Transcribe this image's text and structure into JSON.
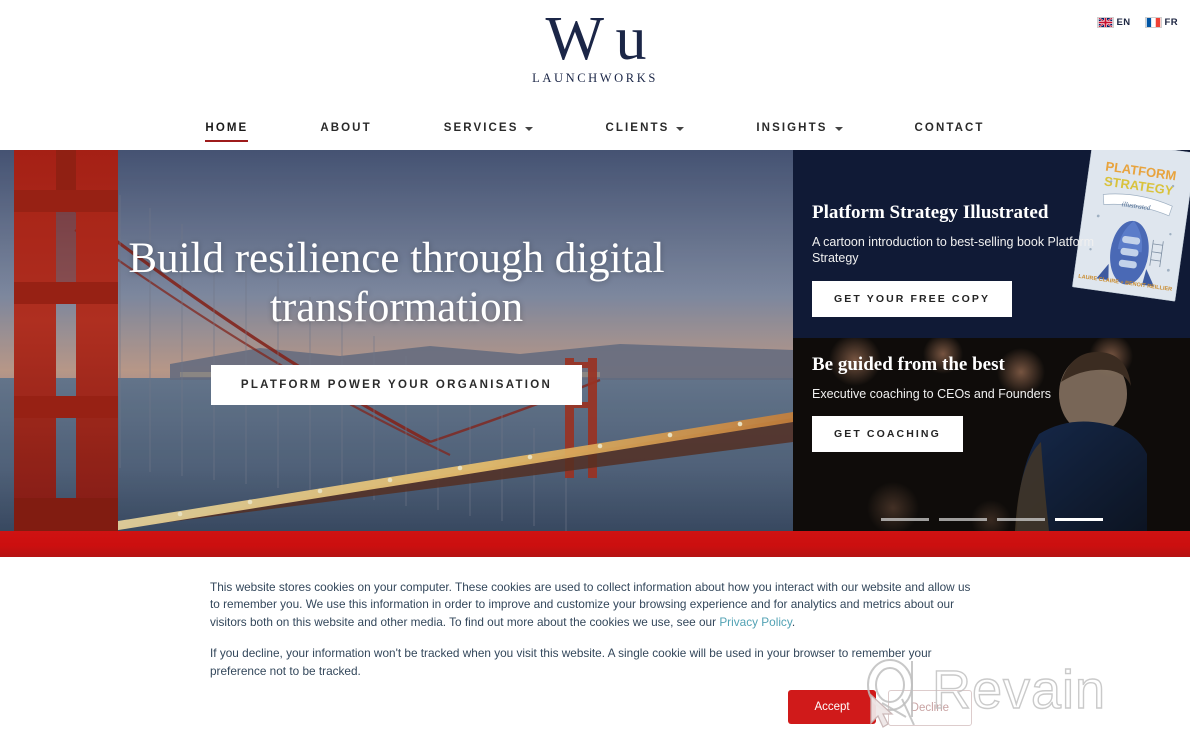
{
  "brand": {
    "logo_letter": "W",
    "logo_overlay": "u",
    "name": "LAUNCHWORKS"
  },
  "language_bar": {
    "items": [
      {
        "code": "EN",
        "flag": "uk-flag-icon"
      },
      {
        "code": "FR",
        "flag": "france-flag-icon"
      }
    ]
  },
  "nav": {
    "items": [
      {
        "label": "HOME",
        "active": true,
        "caret": false
      },
      {
        "label": "ABOUT",
        "active": false,
        "caret": false
      },
      {
        "label": "SERVICES",
        "active": false,
        "caret": true
      },
      {
        "label": "CLIENTS",
        "active": false,
        "caret": true
      },
      {
        "label": "INSIGHTS",
        "active": false,
        "caret": true
      },
      {
        "label": "CONTACT",
        "active": false,
        "caret": false
      }
    ]
  },
  "hero": {
    "title": "Build resilience through digital transformation",
    "cta_label": "PLATFORM POWER YOUR ORGANISATION",
    "image_alt": "golden-gate-bridge-at-dusk"
  },
  "promo_cards": [
    {
      "title": "Platform Strategy Illustrated",
      "subtitle": "A cartoon introduction to best-selling book Platform Strategy",
      "cta_label": "GET YOUR FREE COPY",
      "background": "#101a36",
      "book_title_line1": "PLATFORM",
      "book_title_line2": "STRATEGY",
      "book_script": "illustrated"
    },
    {
      "title": "Be guided from the best",
      "subtitle": "Executive coaching to CEOs and Founders",
      "cta_label": "GET COACHING",
      "background": "#1a1410",
      "image_alt": "woman-looking-up-night-lights"
    }
  ],
  "carousel": {
    "slides": 4,
    "active_index": 3
  },
  "divider": {
    "color": "#cc0f0f"
  },
  "cookie_banner": {
    "paragraph_1_part_1": "This website stores cookies on your computer. These cookies are used to collect information about how you interact with our website and allow us to remember you. We use this information in order to improve and customize your browsing experience and for analytics and metrics about our visitors both on this website and other media. To find out more about the cookies we use, see our ",
    "privacy_link_label": "Privacy Policy",
    "paragraph_1_part_2": ".",
    "paragraph_2": "If you decline, your information won't be tracked when you visit this website. A single cookie will be used in your browser to remember your preference not to be tracked.",
    "accept_label": "Accept",
    "decline_label": "Decline",
    "accept_color": "#d01a1a",
    "link_color": "#52a2b4"
  },
  "watermark": {
    "text": "Revain"
  }
}
